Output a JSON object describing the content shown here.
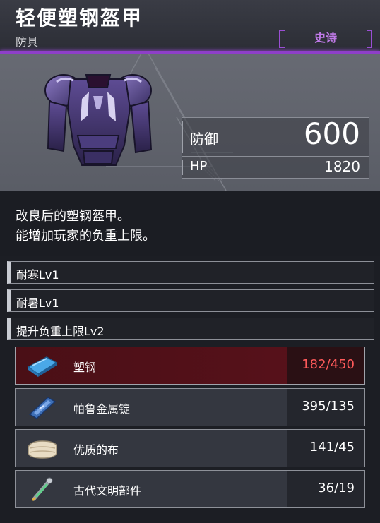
{
  "item": {
    "name": "轻便塑钢盔甲",
    "category": "防具",
    "rarity": "史诗",
    "rarity_color": "#c07ae8"
  },
  "stats": {
    "defense_label": "防御",
    "defense_value": "600",
    "hp_label": "HP",
    "hp_value": "1820"
  },
  "description": {
    "line1": "改良后的塑钢盔甲。",
    "line2": "能增加玩家的负重上限。"
  },
  "skills": [
    {
      "label": "耐寒Lv1"
    },
    {
      "label": "耐暑Lv1"
    },
    {
      "label": "提升负重上限Lv2"
    }
  ],
  "materials": [
    {
      "name": "塑钢",
      "qty": "182/450",
      "insufficient": true,
      "icon": "plasteel-icon"
    },
    {
      "name": "帕鲁金属锭",
      "qty": "395/135",
      "insufficient": false,
      "icon": "pal-metal-ingot-icon"
    },
    {
      "name": "优质的布",
      "qty": "141/45",
      "insufficient": false,
      "icon": "high-quality-cloth-icon"
    },
    {
      "name": "古代文明部件",
      "qty": "36/19",
      "insufficient": false,
      "icon": "ancient-civilization-parts-icon"
    }
  ],
  "colors": {
    "accent_purple": "#8e3fc8",
    "insufficient_red": "#ff5a5a"
  }
}
